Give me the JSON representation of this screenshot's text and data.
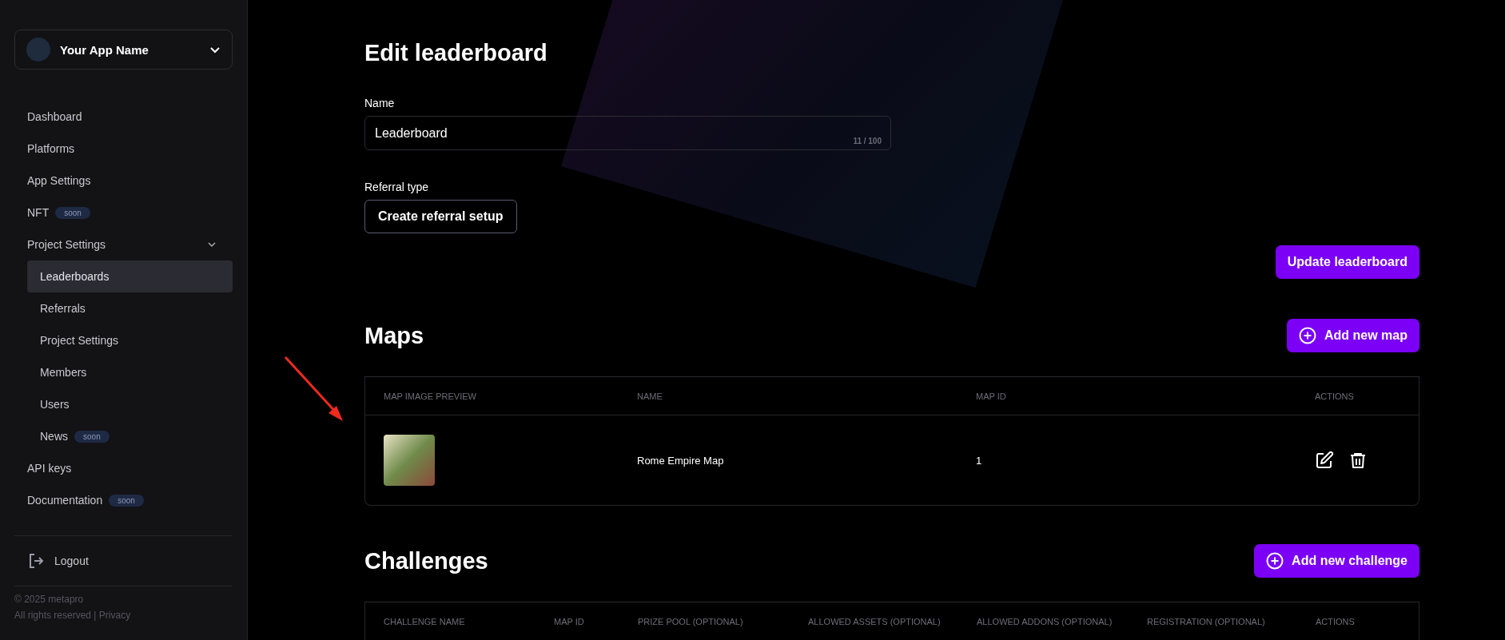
{
  "app_switcher": {
    "name": "Your App Name"
  },
  "nav": [
    {
      "label": "Dashboard",
      "selected": false
    },
    {
      "label": "Platforms",
      "selected": false
    },
    {
      "label": "App Settings",
      "selected": false
    },
    {
      "label": "NFT",
      "selected": false,
      "badge": "soon"
    },
    {
      "label": "Project Settings",
      "selected": false,
      "expanded": true,
      "children": [
        {
          "label": "Leaderboards",
          "selected": true
        },
        {
          "label": "Referrals",
          "selected": false
        },
        {
          "label": "Project Settings",
          "selected": false
        },
        {
          "label": "Members",
          "selected": false
        },
        {
          "label": "Users",
          "selected": false
        },
        {
          "label": "News",
          "selected": false,
          "badge": "soon"
        }
      ]
    },
    {
      "label": "API keys",
      "selected": false
    },
    {
      "label": "Documentation",
      "selected": false,
      "badge": "soon"
    }
  ],
  "logout": "Logout",
  "footer": {
    "copyright": "© 2025 metapro",
    "rights": "All rights reserved |",
    "privacy_link": "Privacy"
  },
  "page_title": "Edit leaderboard",
  "name_field": {
    "label": "Name",
    "value": "Leaderboard",
    "counter": "11 / 100"
  },
  "referral": {
    "label": "Referral type",
    "button": "Create referral setup"
  },
  "update_button": "Update leaderboard",
  "maps": {
    "title": "Maps",
    "add_button": "Add new map",
    "columns": [
      "MAP IMAGE PREVIEW",
      "NAME",
      "MAP ID",
      "ACTIONS"
    ],
    "rows": [
      {
        "name": "Rome Empire Map",
        "map_id": "1"
      }
    ]
  },
  "challenges": {
    "title": "Challenges",
    "add_button": "Add new challenge",
    "columns": [
      "CHALLENGE NAME",
      "MAP ID",
      "PRIZE POOL (OPTIONAL)",
      "ALLOWED ASSETS (OPTIONAL)",
      "ALLOWED ADDONS (OPTIONAL)",
      "REGISTRATION (OPTIONAL)",
      "ACTIONS"
    ]
  }
}
